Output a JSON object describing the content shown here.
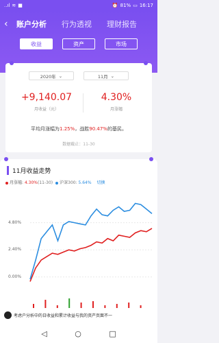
{
  "status_bar": {
    "time": "16:17",
    "battery": "81%",
    "signal": "..ıl"
  },
  "nav": {
    "back_icon": "chevron-left-icon",
    "tabs": [
      {
        "label": "账户分析",
        "active": true
      },
      {
        "label": "行为透视",
        "active": false
      },
      {
        "label": "理财报告",
        "active": false
      }
    ]
  },
  "pills": [
    {
      "label": "收益",
      "active": true
    },
    {
      "label": "资产",
      "active": false
    },
    {
      "label": "市场",
      "active": false
    }
  ],
  "summary_card": {
    "year": "2020年",
    "month": "11月",
    "monthly_income": "+9,140.07",
    "monthly_income_label": "月收益（元）",
    "monthly_gain": "4.30%",
    "monthly_gain_label": "月涨幅",
    "summary_prefix": "平均月涨幅为",
    "avg_gain": "1.25%",
    "summary_mid": "，战胜",
    "beat_pct": "90.47%",
    "summary_suffix": "的基民。",
    "as_of": "数据截止：11-30"
  },
  "trend_card": {
    "title": "11月收益走势",
    "legend_self_label": "月涨幅: ",
    "legend_self_value": "4.30%",
    "legend_self_date": "(11-30)",
    "legend_index_label": "沪深300: ",
    "legend_index_value": "5.64%",
    "switch_label": "切换",
    "bottom_text": "考虑户分析中的日收益和累计收益与我的资产页面不一"
  },
  "chart_data": {
    "type": "line",
    "y_ticks": [
      "4.80%",
      "2.40%",
      "0.00%"
    ],
    "ylim": [
      -0.8,
      7.2
    ],
    "series": [
      {
        "name": "月涨幅",
        "color": "#e02020",
        "values": [
          -0.4,
          0.8,
          1.5,
          1.8,
          2.1,
          2.0,
          2.2,
          2.4,
          2.3,
          2.5,
          2.6,
          2.8,
          3.1,
          3.0,
          3.4,
          3.2,
          3.7,
          3.6,
          3.5,
          3.9,
          4.1,
          4.0,
          4.3
        ]
      },
      {
        "name": "沪深300",
        "color": "#2b8de0",
        "values": [
          -0.2,
          1.5,
          3.4,
          4.0,
          4.6,
          3.2,
          4.6,
          4.9,
          4.8,
          4.7,
          4.6,
          5.4,
          6.0,
          5.5,
          5.4,
          5.9,
          6.2,
          5.8,
          5.9,
          6.5,
          6.4,
          6.0,
          5.6
        ]
      }
    ],
    "bars": [
      0.3,
      0.6,
      0.2,
      0.7,
      0.4,
      0.5,
      0.2,
      0.3,
      0.4,
      0.2
    ],
    "bar_colors": [
      "#e02020",
      "#e02020",
      "#e02020",
      "#2ca02c",
      "#e02020",
      "#e02020",
      "#e02020",
      "#e02020",
      "#e02020",
      "#e02020"
    ]
  },
  "system_nav": {
    "back": "◁",
    "home": "○",
    "recent": "□"
  }
}
